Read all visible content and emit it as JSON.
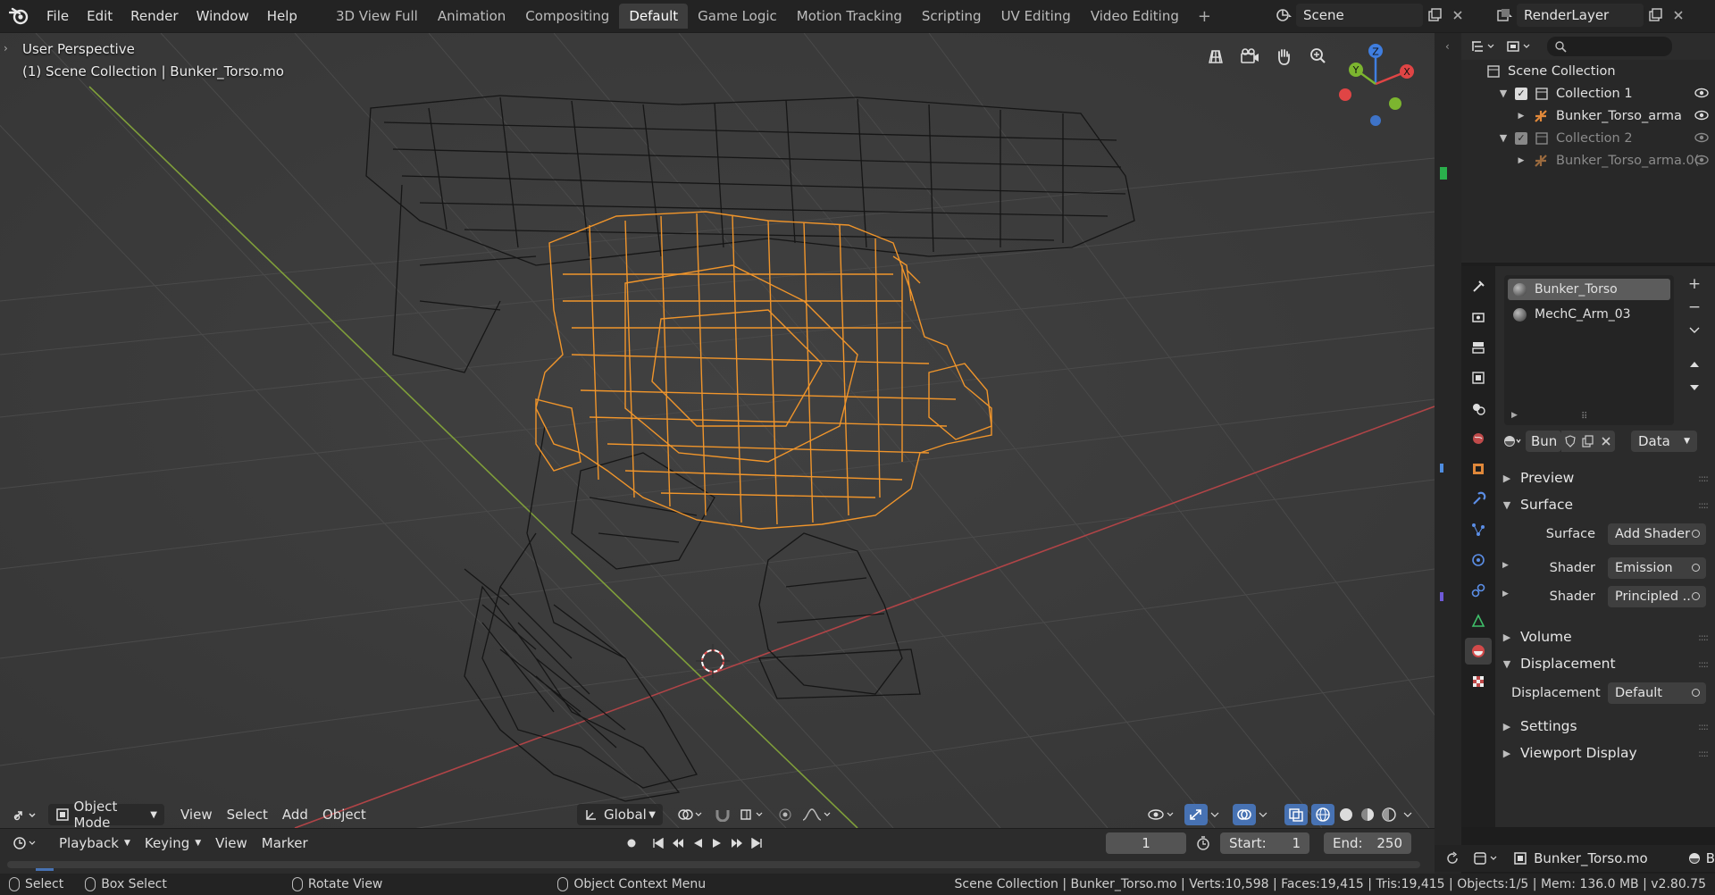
{
  "menu": [
    "File",
    "Edit",
    "Render",
    "Window",
    "Help"
  ],
  "workspace_tabs": [
    "3D View Full",
    "Animation",
    "Compositing",
    "Default",
    "Game Logic",
    "Motion Tracking",
    "Scripting",
    "UV Editing",
    "Video Editing"
  ],
  "active_tab": "Default",
  "add_tab": "+",
  "scene": {
    "name": "Scene",
    "render_layer": "RenderLayer"
  },
  "viewport": {
    "perspective": "User Perspective",
    "collection_info": "(1) Scene Collection | Bunker_Torso.mo",
    "gizmo": {
      "x": "X",
      "y": "Y",
      "z": "Z"
    },
    "header": {
      "mode": "Object Mode",
      "menus": [
        "View",
        "Select",
        "Add",
        "Object"
      ],
      "orientation": "Global"
    },
    "colors": {
      "background": "#3b3b3b",
      "selected_wire": "#f0952b",
      "wire": "#141414",
      "x_axis": "#b04447",
      "y_axis": "#7f9e3a"
    }
  },
  "timeline": {
    "menus": [
      "Playback",
      "Keying",
      "View",
      "Marker"
    ],
    "current_frame": "1",
    "start_label": "Start:",
    "start": "1",
    "end_label": "End:",
    "end": "250"
  },
  "outliner": {
    "root": "Scene Collection",
    "items": [
      {
        "label": "Collection 1",
        "type": "collection",
        "dim": false
      },
      {
        "label": "Bunker_Torso_arma",
        "type": "armature",
        "dim": false
      },
      {
        "label": "Collection 2",
        "type": "collection",
        "dim": true
      },
      {
        "label": "Bunker_Torso_arma.0(",
        "type": "armature",
        "dim": true
      }
    ]
  },
  "properties": {
    "materials": [
      "Bunker_Torso",
      "MechC_Arm_03"
    ],
    "datablock_name": "Bun",
    "link": "Data",
    "panels": {
      "preview": "Preview",
      "surface": "Surface",
      "surface_label": "Surface",
      "surface_value": "Add Shader",
      "shader1_label": "Shader",
      "shader1_value": "Emission",
      "shader2_label": "Shader",
      "shader2_value": "Principled ..",
      "volume": "Volume",
      "displacement": "Displacement",
      "displacement_label": "Displacement",
      "displacement_value": "Default",
      "settings": "Settings",
      "viewport_display": "Viewport Display"
    },
    "footer_object": "Bunker_Torso.mo",
    "footer_trailing": "B"
  },
  "status": {
    "select": "Select",
    "box_select": "Box Select",
    "rotate_view": "Rotate View",
    "context_menu": "Object Context Menu",
    "stats": "Scene Collection | Bunker_Torso.mo | Verts:10,598 | Faces:19,415 | Tris:19,415 | Objects:1/5 | Mem: 136.0 MB | v2.80.75"
  }
}
